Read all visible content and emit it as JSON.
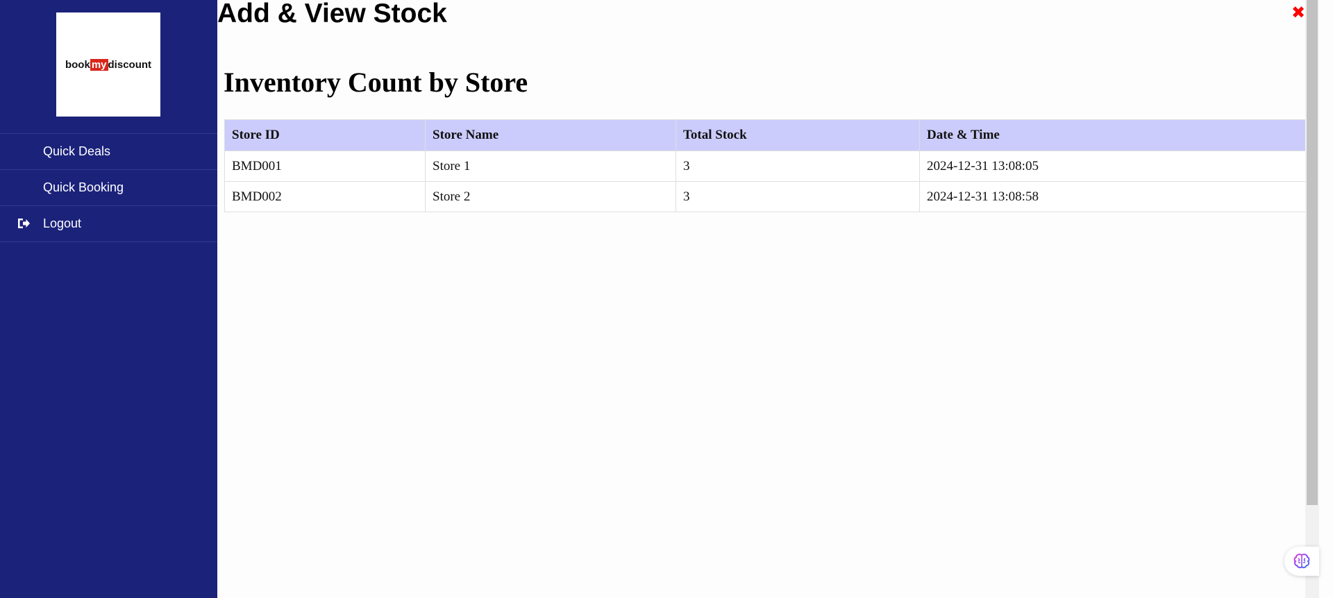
{
  "sidebar": {
    "logo": {
      "part1": "book",
      "part2": "my",
      "part3": "discount"
    },
    "items": [
      {
        "label": "Quick Deals",
        "icon": ""
      },
      {
        "label": "Quick Booking",
        "icon": ""
      },
      {
        "label": "Logout",
        "icon": "sign-out-icon"
      }
    ]
  },
  "main": {
    "title": "Add & View Stock",
    "close_symbol": "✖",
    "section_title": "Inventory Count by Store",
    "table": {
      "headers": [
        "Store ID",
        "Store Name",
        "Total Stock",
        "Date & Time"
      ],
      "rows": [
        [
          "BMD001",
          "Store 1",
          "3",
          "2024-12-31 13:08:05"
        ],
        [
          "BMD002",
          "Store 2",
          "3",
          "2024-12-31 13:08:58"
        ]
      ]
    }
  },
  "colors": {
    "sidebar_bg": "#1b227a",
    "table_header_bg": "#ccccfc",
    "close_red": "#ff0000",
    "logo_accent": "#d9261c"
  },
  "floating_button": {
    "icon": "brain-icon"
  }
}
